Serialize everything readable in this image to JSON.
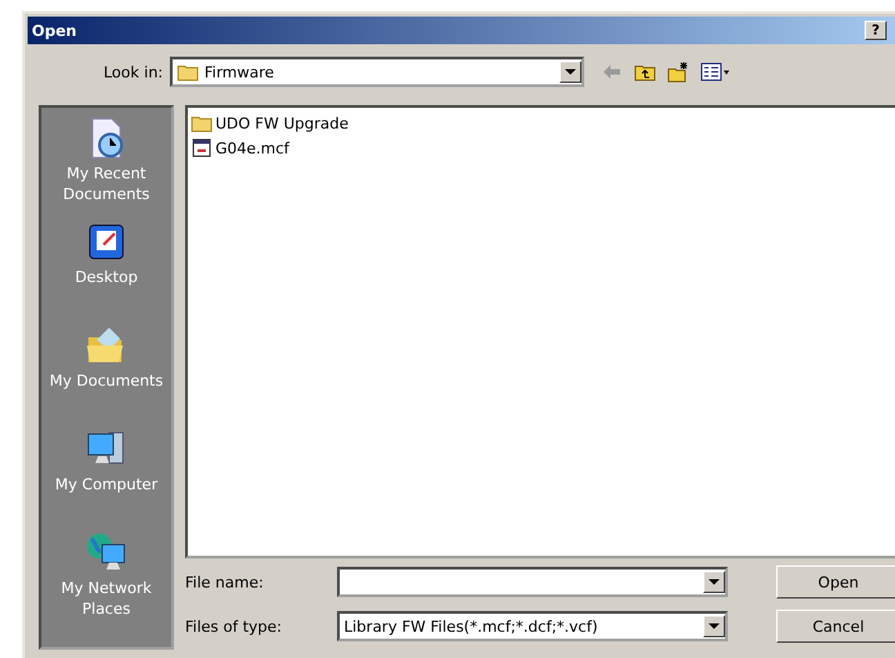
{
  "window": {
    "title": "Open",
    "help_button": "?"
  },
  "look_in": {
    "label": "Look in:",
    "value": "Firmware"
  },
  "places": [
    {
      "label": "My Recent Documents",
      "kind": "recent"
    },
    {
      "label": "Desktop",
      "kind": "desktop"
    },
    {
      "label": "My Documents",
      "kind": "documents"
    },
    {
      "label": "My Computer",
      "kind": "computer"
    },
    {
      "label": "My Network Places",
      "kind": "network"
    }
  ],
  "files": [
    {
      "name": "UDO FW Upgrade",
      "kind": "folder"
    },
    {
      "name": "G04e.mcf",
      "kind": "file"
    }
  ],
  "file_name": {
    "label": "File name:"
  },
  "file_type": {
    "label": "Files of type:",
    "value": "Library FW Files(*.mcf;*.dcf;*.vcf)"
  },
  "buttons": [
    "Open",
    "Cancel"
  ]
}
